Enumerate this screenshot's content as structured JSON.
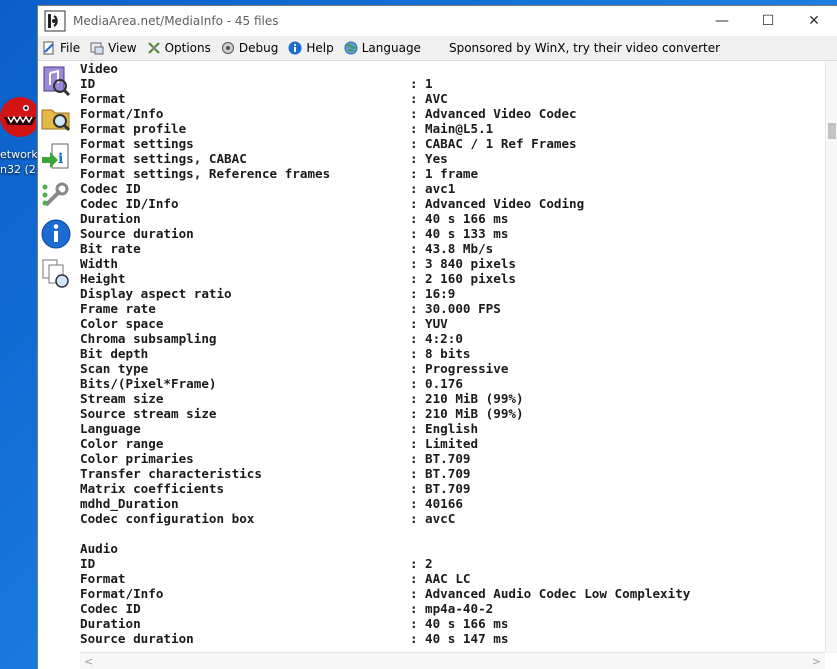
{
  "desktop": {
    "icon_label_1": "etwork",
    "icon_label_2": "n32 (2..."
  },
  "window": {
    "title": "MediaArea.net/MediaInfo - 45 files",
    "minimize_glyph": "—",
    "maximize_glyph": "☐",
    "close_glyph": "✕"
  },
  "menu": {
    "items": [
      {
        "label": "File",
        "icon": "file-icon"
      },
      {
        "label": "View",
        "icon": "view-icon"
      },
      {
        "label": "Options",
        "icon": "options-icon"
      },
      {
        "label": "Debug",
        "icon": "debug-icon"
      },
      {
        "label": "Help",
        "icon": "help-icon"
      },
      {
        "label": "Language",
        "icon": "language-icon"
      }
    ],
    "sponsor": "Sponsored by WinX, try their video converter"
  },
  "sidebar": [
    "open-file-icon",
    "open-folder-icon",
    "export-icon",
    "about-icon",
    "preferences-icon",
    "info-icon",
    "donate-icon"
  ],
  "colon": ":",
  "sections": [
    {
      "heading": "Video",
      "rows": [
        {
          "k": "ID",
          "v": "1"
        },
        {
          "k": "Format",
          "v": "AVC"
        },
        {
          "k": "Format/Info",
          "v": "Advanced Video Codec"
        },
        {
          "k": "Format profile",
          "v": "Main@L5.1"
        },
        {
          "k": "Format settings",
          "v": "CABAC / 1 Ref Frames"
        },
        {
          "k": "Format settings, CABAC",
          "v": "Yes"
        },
        {
          "k": "Format settings, Reference frames",
          "v": "1 frame"
        },
        {
          "k": "Codec ID",
          "v": "avc1"
        },
        {
          "k": "Codec ID/Info",
          "v": "Advanced Video Coding"
        },
        {
          "k": "Duration",
          "v": "40 s 166 ms"
        },
        {
          "k": "Source duration",
          "v": "40 s 133 ms"
        },
        {
          "k": "Bit rate",
          "v": "43.8 Mb/s"
        },
        {
          "k": "Width",
          "v": "3 840 pixels"
        },
        {
          "k": "Height",
          "v": "2 160 pixels"
        },
        {
          "k": "Display aspect ratio",
          "v": "16:9"
        },
        {
          "k": "Frame rate",
          "v": "30.000 FPS"
        },
        {
          "k": "Color space",
          "v": "YUV"
        },
        {
          "k": "Chroma subsampling",
          "v": "4:2:0"
        },
        {
          "k": "Bit depth",
          "v": "8 bits"
        },
        {
          "k": "Scan type",
          "v": "Progressive"
        },
        {
          "k": "Bits/(Pixel*Frame)",
          "v": "0.176"
        },
        {
          "k": "Stream size",
          "v": "210 MiB (99%)"
        },
        {
          "k": "Source stream size",
          "v": "210 MiB (99%)"
        },
        {
          "k": "Language",
          "v": "English"
        },
        {
          "k": "Color range",
          "v": "Limited"
        },
        {
          "k": "Color primaries",
          "v": "BT.709"
        },
        {
          "k": "Transfer characteristics",
          "v": "BT.709"
        },
        {
          "k": "Matrix coefficients",
          "v": "BT.709"
        },
        {
          "k": "mdhd_Duration",
          "v": "40166"
        },
        {
          "k": "Codec configuration box",
          "v": "avcC"
        }
      ]
    },
    {
      "heading": "Audio",
      "rows": [
        {
          "k": "ID",
          "v": "2"
        },
        {
          "k": "Format",
          "v": "AAC LC"
        },
        {
          "k": "Format/Info",
          "v": "Advanced Audio Codec Low Complexity"
        },
        {
          "k": "Codec ID",
          "v": "mp4a-40-2"
        },
        {
          "k": "Duration",
          "v": "40 s 166 ms"
        },
        {
          "k": "Source duration",
          "v": "40 s 147 ms"
        }
      ]
    }
  ],
  "hscroll": {
    "left_arrow": "<",
    "right_arrow": ">"
  },
  "colors": {
    "text": "#1a1a1a",
    "desktop": "#1a7fe0"
  }
}
